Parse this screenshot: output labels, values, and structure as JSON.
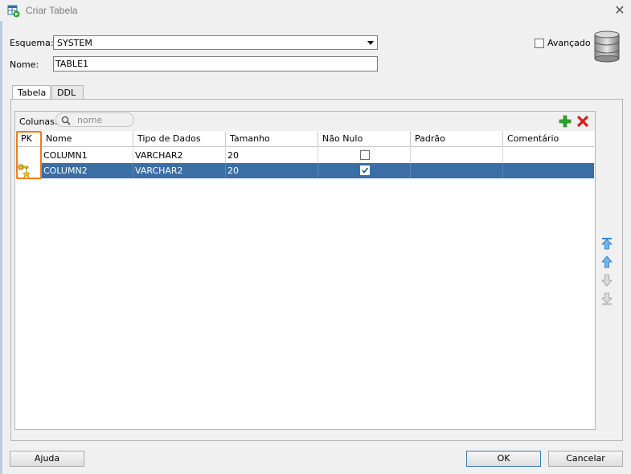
{
  "window": {
    "title": "Criar Tabela"
  },
  "form": {
    "schema_label": "Esquema:",
    "schema_value": "SYSTEM",
    "name_label": "Nome:",
    "name_value": "TABLE1",
    "advanced_label": "Avançado",
    "advanced_checked": false
  },
  "tabs": [
    {
      "label": "Tabela",
      "active": true
    },
    {
      "label": "DDL",
      "active": false
    }
  ],
  "columns_toolbar": {
    "label": "Colunas:",
    "search_placeholder": "nome"
  },
  "grid": {
    "headers": [
      "PK",
      "Nome",
      "Tipo de Dados",
      "Tamanho",
      "Não Nulo",
      "Padrão",
      "Comentário"
    ],
    "rows": [
      {
        "pk": false,
        "name": "COLUMN1",
        "type": "VARCHAR2",
        "size": "20",
        "not_null": false,
        "default": "",
        "comment": "",
        "selected": false
      },
      {
        "pk": true,
        "name": "COLUMN2",
        "type": "VARCHAR2",
        "size": "20",
        "not_null": true,
        "default": "",
        "comment": "",
        "selected": true
      }
    ]
  },
  "buttons": {
    "help": "Ajuda",
    "ok": "OK",
    "cancel": "Cancelar"
  },
  "colors": {
    "selection": "#3a6ea5",
    "highlight": "#f07d14",
    "add": "#2ea52e",
    "remove": "#d42020"
  }
}
